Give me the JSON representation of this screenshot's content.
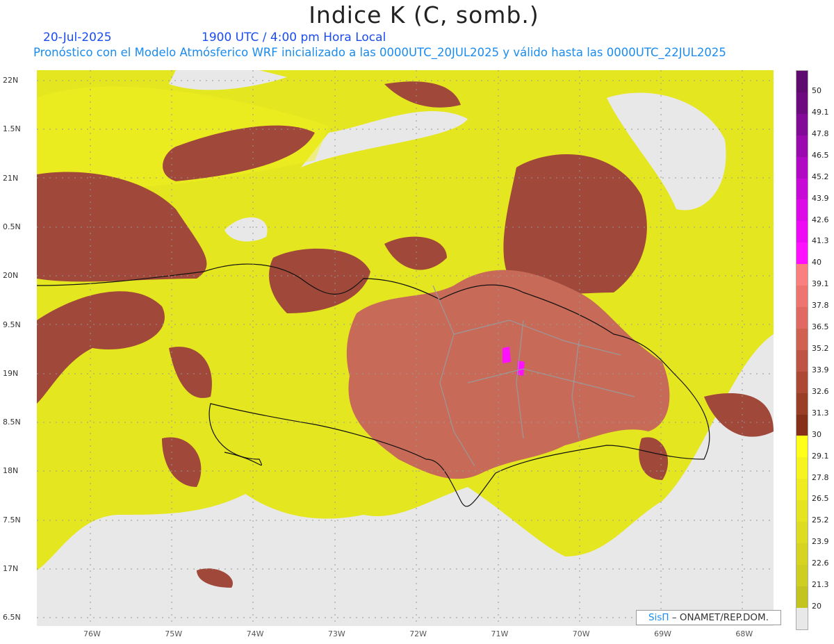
{
  "header": {
    "title": "Indice K (C, somb.)",
    "date": "20-Jul-2025",
    "time": "1900 UTC / 4:00 pm Hora Local",
    "subtitle": "Pronóstico con el Modelo Atmósferico WRF inicializado a las 0000UTC_20JUL2025 y válido hasta las  0000UTC_22JUL2025"
  },
  "lat_labels": [
    "22N",
    "1.5N",
    "21N",
    "0.5N",
    "20N",
    "9.5N",
    "19N",
    "8.5N",
    "18N",
    "7.5N",
    "17N",
    "6.5N"
  ],
  "lon_labels": [
    "76W",
    "75W",
    "74W",
    "73W",
    "72W",
    "71W",
    "70W",
    "69W",
    "68W"
  ],
  "colorbar": {
    "labels": [
      "50",
      "49.1",
      "47.8",
      "46.5",
      "45.2",
      "43.9",
      "42.6",
      "41.3",
      "40",
      "39.1",
      "37.8",
      "36.5",
      "35.2",
      "33.9",
      "32.6",
      "31.3",
      "30",
      "29.1",
      "27.8",
      "26.5",
      "25.2",
      "23.9",
      "22.6",
      "21.3",
      "20"
    ],
    "colors": [
      "#5e0a6e",
      "#6e0a80",
      "#820a96",
      "#9a0aae",
      "#b00ac4",
      "#c80ad6",
      "#dc0ae6",
      "#ee0af4",
      "#ff10ff",
      "#fa8080",
      "#ee7470",
      "#e06a62",
      "#d06050",
      "#bf5444",
      "#ac4834",
      "#9a3e26",
      "#86301a",
      "#ffff1a",
      "#f6f41e",
      "#eeec20",
      "#e6e420",
      "#dedc20",
      "#d6d420",
      "#cece20",
      "#c4c420",
      "#e8e8e8"
    ]
  },
  "logo": {
    "brand": "SisΠ",
    "text": "– ONAMET/REP.DOM."
  }
}
